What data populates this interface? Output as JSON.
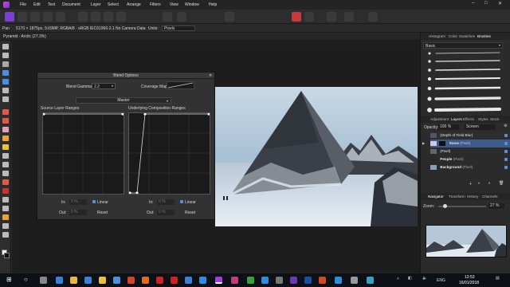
{
  "menubar": {
    "items": [
      "File",
      "Edit",
      "Text",
      "Document",
      "Layer",
      "Select",
      "Arrange",
      "Filters",
      "View",
      "Window",
      "Help"
    ]
  },
  "context": {
    "info": "5170 × 1875px, 9.69MP, RGBA/8 · sRGB IEC61966-2.1",
    "camera": "No Camera Data",
    "units_label": "Units:",
    "units_value": "Pixels"
  },
  "doctab": {
    "title": "Pyramid - Arctic (27.3%)"
  },
  "blend": {
    "title": "Blend Options",
    "gamma_label": "Blend Gamma:",
    "gamma_value": "2.2",
    "coverage_label": "Coverage Map:",
    "channel": "Master",
    "source_title": "Source Layer Ranges",
    "underlying_title": "Underlying Composition Ranges",
    "in_label": "In:",
    "out_label": "Out:",
    "in_value": "0 %",
    "out_value": "0 %",
    "linear_label": "Linear",
    "reset_label": "Reset"
  },
  "rpanel": {
    "top_tabs": [
      "Histogram",
      "Color",
      "Swatches",
      "Brushes"
    ],
    "brush_category": "Basic",
    "mid_tabs": [
      "Adjustment",
      "Layers",
      "Effects",
      "Styles",
      "Stock"
    ],
    "opacity_label": "Opacity:",
    "opacity_value": "100 %",
    "blend_mode": "Screen",
    "layers": [
      {
        "name": "(Depth of Field Blur)"
      },
      {
        "name": "Snow",
        "suffix": "(Pixel)"
      },
      {
        "name": "(Pixel)"
      },
      {
        "name": "People",
        "suffix": "(Pixel)"
      },
      {
        "name": "Background",
        "suffix": "(Pixel)"
      }
    ],
    "nav_tabs": [
      "Navigator",
      "Transform",
      "History",
      "Channels"
    ],
    "zoom_label": "Zoom:",
    "zoom_value": "27 %"
  },
  "taskbar": {
    "time": "12:53",
    "date": "16/01/2018",
    "lang": "ENG"
  }
}
